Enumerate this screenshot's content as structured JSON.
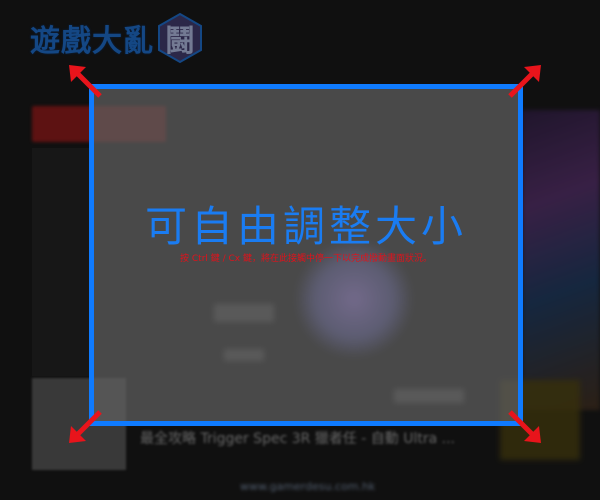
{
  "site": {
    "logo_text": "遊戲大亂",
    "logo_badge": "鬪"
  },
  "article": {
    "headline": "最全攻略 Trigger Spec 3R 獵者任 - 自動 Ultra ...",
    "footer_link": "www.gamerdesu.com.hk"
  },
  "resize_overlay": {
    "title": "可自由調整大小",
    "subtitle": "按 Ctrl 鍵 / Cx 鍵，將在此接觸中停一下以完成撥動畫面狀況。",
    "accent_color": "#0f7bff",
    "subtitle_color": "#e0121b"
  }
}
